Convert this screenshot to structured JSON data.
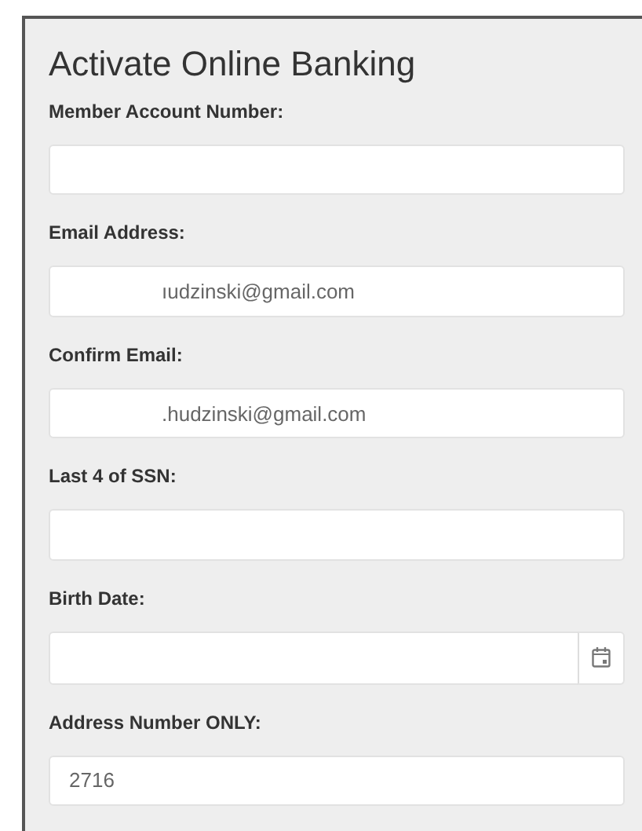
{
  "title": "Activate Online Banking",
  "fields": [
    {
      "label": "Member Account Number:",
      "kind": "text"
    },
    {
      "label": "Email Address:",
      "kind": "text",
      "value": "ıudzinski@gmail.com",
      "redacted": true
    },
    {
      "label": "Confirm Email:",
      "kind": "text",
      "value": ".hudzinski@gmail.com",
      "redacted": true
    },
    {
      "label": "Last 4 of SSN:",
      "kind": "text"
    },
    {
      "label": "Birth Date:",
      "kind": "date"
    },
    {
      "label": "Address Number ONLY:",
      "kind": "text",
      "value": "2716"
    }
  ]
}
